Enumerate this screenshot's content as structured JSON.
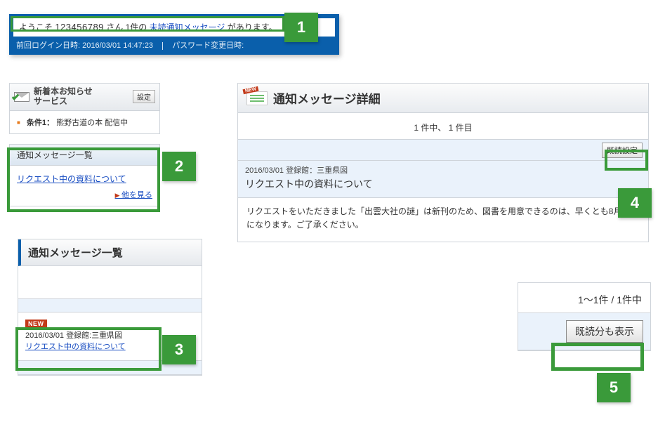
{
  "colors": {
    "accent_green": "#3a9a3a",
    "accent_blue": "#0a5fab",
    "badge_red": "#c23a1a"
  },
  "callouts": [
    "1",
    "2",
    "3",
    "4",
    "5"
  ],
  "header": {
    "greeting_prefix": "ようこそ ",
    "user_id": "123456789",
    "greeting_mid": " さん 1件の",
    "unread_link": "未読通知メッセージ",
    "greeting_suffix": "があります。",
    "prev_login_label": "前回ログイン日時:",
    "prev_login_value": "2016/03/01 14:47:23",
    "pw_changed_label": "パスワード変更日時:"
  },
  "sidebar": {
    "notice_title": "新着本お知らせ\nサービス",
    "settings_btn": "設定",
    "condition_label": "条件1：",
    "condition_text": "熊野古道の本 配信中",
    "msglist_head": "通知メッセージ一覧",
    "msglist_link": "リクエスト中の資料について",
    "msglist_more": "他を見る"
  },
  "list_block": {
    "title": "通知メッセージ一覧",
    "item": {
      "new_badge": "NEW",
      "date": "2016/03/01",
      "source_label": "登録館:",
      "source_name": "三重県図",
      "subject_link": "リクエスト中の資料について"
    }
  },
  "detail": {
    "title": "通知メッセージ詳細",
    "count_text": "1 件中、 1 件目",
    "mark_read_btn": "既読設定",
    "meta_date": "2016/03/01",
    "meta_source_label": "登録館：",
    "meta_source": "三重県図",
    "subject": "リクエスト中の資料について",
    "body": "リクエストをいただきました「出雲大社の謎」は新刊のため、図書を用意できるのは、早くとも8月以降になります。ご了承ください。"
  },
  "pager": {
    "range_text": "1〜1件 / 1件中",
    "show_read_btn": "既読分も表示"
  }
}
